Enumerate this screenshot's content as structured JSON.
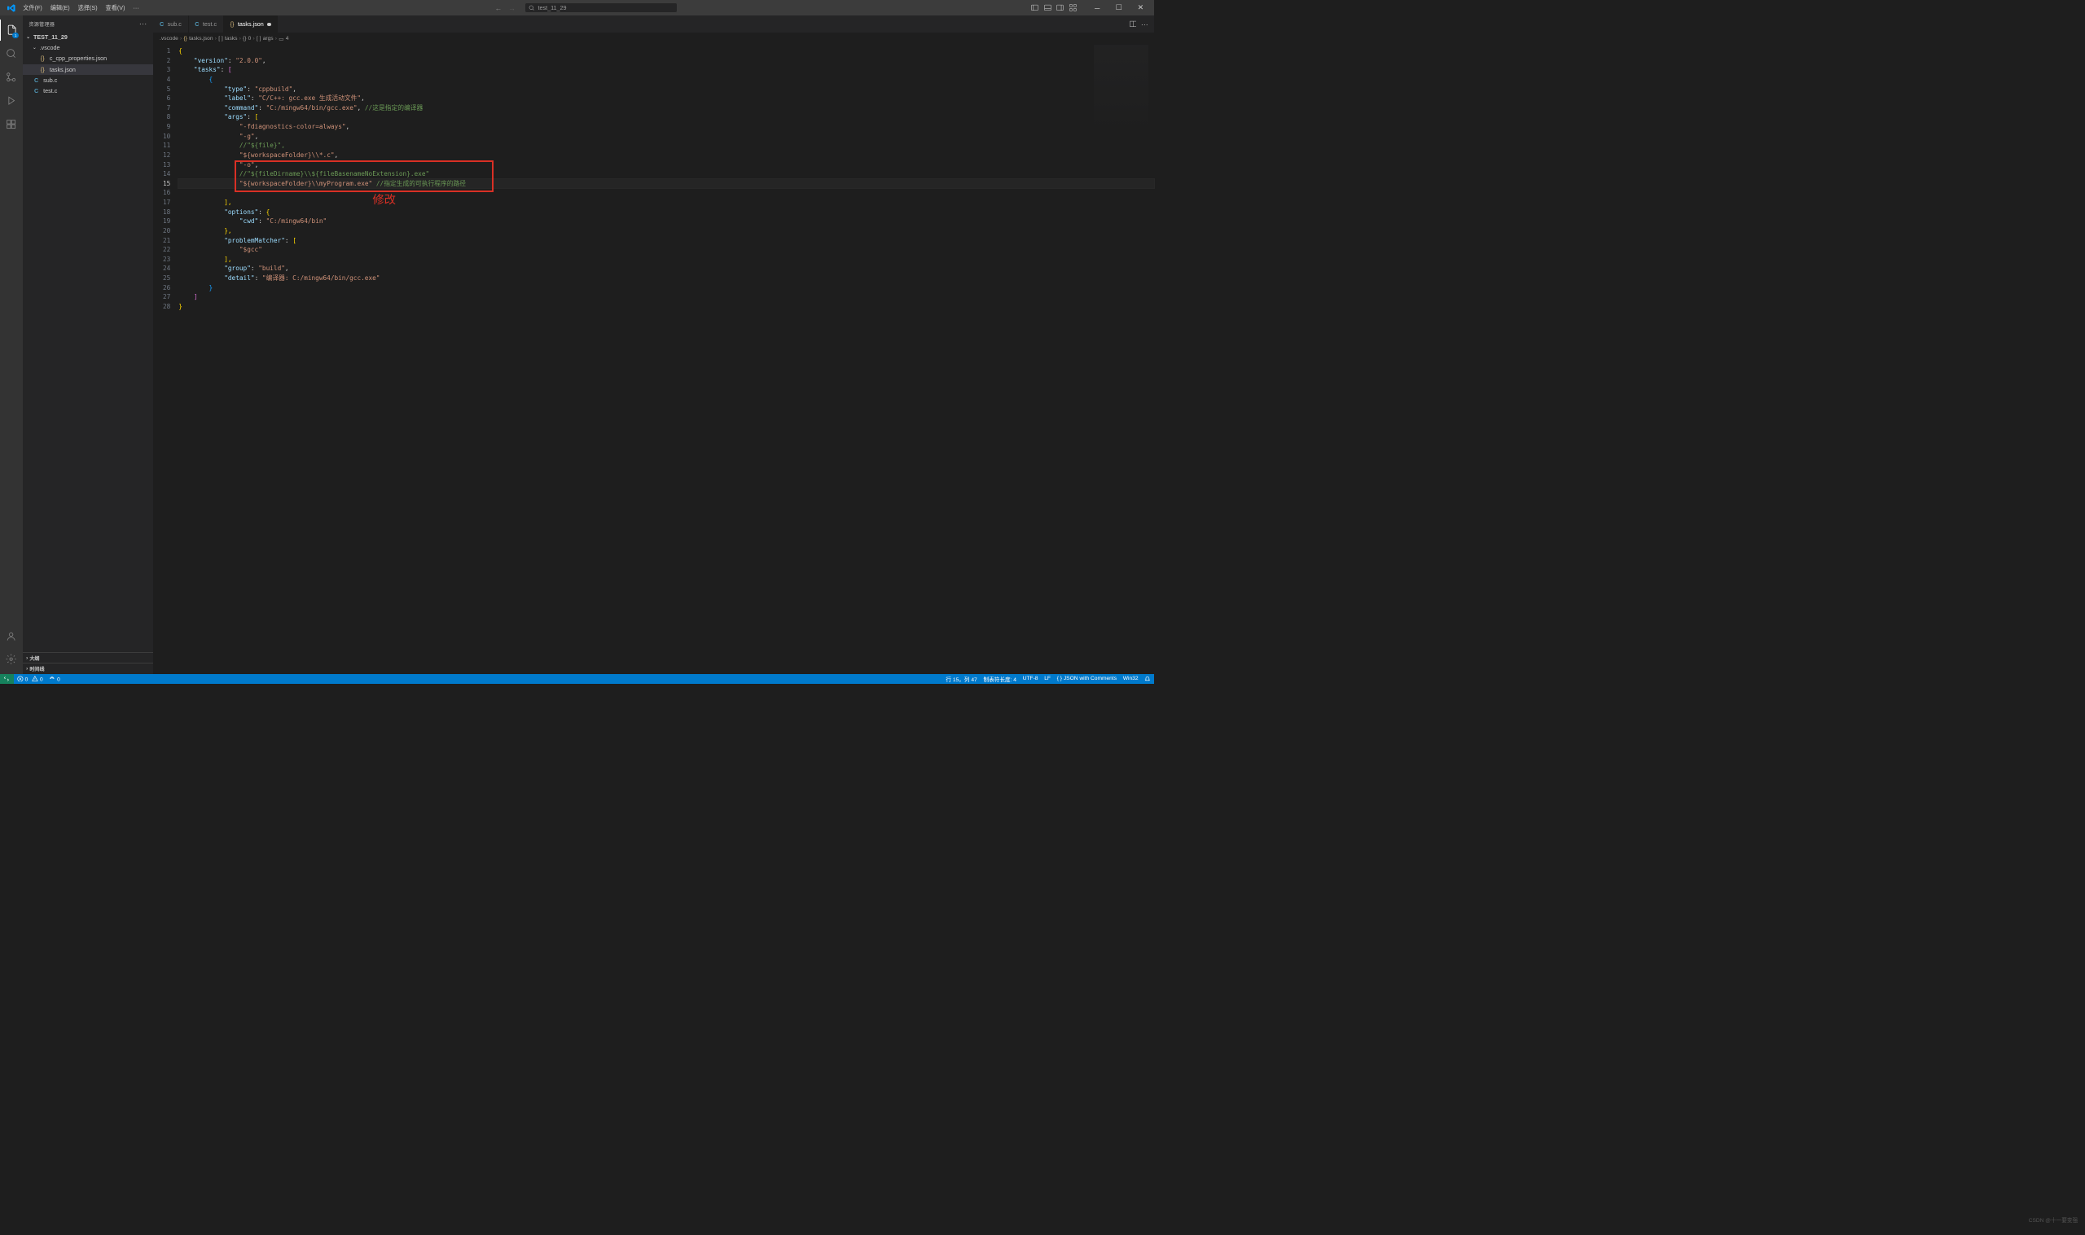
{
  "menu": {
    "file": "文件(F)",
    "edit": "编辑(E)",
    "select": "选择(S)",
    "view": "查看(V)",
    "more": "···"
  },
  "search": {
    "placeholder": "test_11_29"
  },
  "sidebar": {
    "title": "资源管理器",
    "root": "TEST_11_29",
    "vscode_folder": ".vscode",
    "files": {
      "cprops": "c_cpp_properties.json",
      "tasks": "tasks.json",
      "subc": "sub.c",
      "testc": "test.c"
    },
    "outline": "大纲",
    "timeline": "时间线"
  },
  "tabs": {
    "sub": "sub.c",
    "test": "test.c",
    "tasks": "tasks.json"
  },
  "breadcrumb": {
    "vscode": ".vscode",
    "tasks": "tasks.json",
    "tasksArr": "tasks",
    "zero": "0",
    "args": "args",
    "four": "4"
  },
  "activity_badge": "1",
  "code": {
    "l1": "{",
    "l2a": "    \"version\"",
    "l2b": ": ",
    "l2c": "\"2.0.0\"",
    "l2d": ",",
    "l3a": "    \"tasks\"",
    "l3b": ": ",
    "l3c": "[",
    "l4": "        {",
    "l5a": "            \"type\"",
    "l5b": ": ",
    "l5c": "\"cppbuild\"",
    "l5d": ",",
    "l6a": "            \"label\"",
    "l6b": ": ",
    "l6c": "\"C/C++: gcc.exe 生成活动文件\"",
    "l6d": ",",
    "l7a": "            \"command\"",
    "l7b": ": ",
    "l7c": "\"C:/mingw64/bin/gcc.exe\"",
    "l7d": ", ",
    "l7e": "//这是指定的编译器",
    "l8a": "            \"args\"",
    "l8b": ": ",
    "l8c": "[",
    "l9a": "                \"-fdiagnostics-color=always\"",
    "l9b": ",",
    "l10a": "                \"-g\"",
    "l10b": ",",
    "l11": "                //\"${file}\",",
    "l12a": "                \"${workspaceFolder}\\\\*.c\"",
    "l12b": ",",
    "l13a": "                \"-o\"",
    "l13b": ",",
    "l14": "                //\"${fileDirname}\\\\${fileBasenameNoExtension}.exe\"",
    "l15a": "                \"${workspaceFolder}\\\\myProgram.exe\"",
    "l15b": " ",
    "l15c": "//指定生成的可执行程序的路径",
    "l16": "                ",
    "l17": "            ],",
    "l18a": "            \"options\"",
    "l18b": ": ",
    "l18c": "{",
    "l19a": "                \"cwd\"",
    "l19b": ": ",
    "l19c": "\"C:/mingw64/bin\"",
    "l20": "            },",
    "l21a": "            \"problemMatcher\"",
    "l21b": ": ",
    "l21c": "[",
    "l22": "                \"$gcc\"",
    "l23": "            ],",
    "l24a": "            \"group\"",
    "l24b": ": ",
    "l24c": "\"build\"",
    "l24d": ",",
    "l25a": "            \"detail\"",
    "l25b": ": ",
    "l25c": "\"编译器: C:/mingw64/bin/gcc.exe\"",
    "l26": "        }",
    "l27": "    ]",
    "l28": "}"
  },
  "annotation": "修改",
  "status": {
    "errors": "0",
    "warnings": "0",
    "port": "0",
    "line_col": "行 15，列 47",
    "tabsize": "制表符长度: 4",
    "encoding": "UTF-8",
    "eol": "LF",
    "lang": "JSON with Comments",
    "win32": "Win32"
  },
  "watermark": "CSDN @十一要变强"
}
